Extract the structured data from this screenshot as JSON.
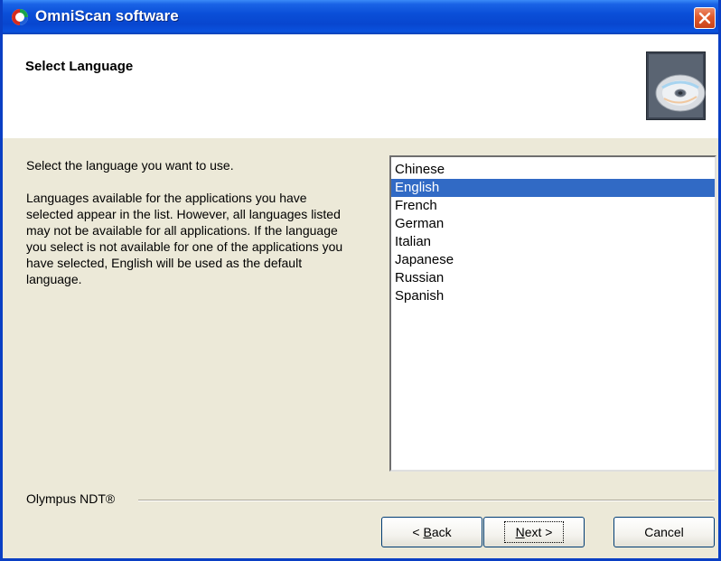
{
  "window": {
    "title": "OmniScan software"
  },
  "header": {
    "title": "Select Language",
    "icon": "cd-disc-icon"
  },
  "description": {
    "line1": "Select the language you want to use.",
    "line2": "Languages available for the applications you have selected appear in the list.  However, all languages listed may not be available for all applications.  If the language you select is not available for one of the applications you have selected, English will be used as the default language."
  },
  "languages": {
    "items": [
      "Chinese",
      "English",
      "French",
      "German",
      "Italian",
      "Japanese",
      "Russian",
      "Spanish"
    ],
    "selected": "English"
  },
  "footer": {
    "brand": "Olympus NDT®",
    "back_prefix": "< ",
    "back_key": "B",
    "back_rest": "ack",
    "next_key": "N",
    "next_rest": "ext >",
    "cancel_label": "Cancel"
  },
  "colors": {
    "titlebar": "#0a4fd8",
    "selection": "#316ac5",
    "close": "#e05a2c"
  }
}
